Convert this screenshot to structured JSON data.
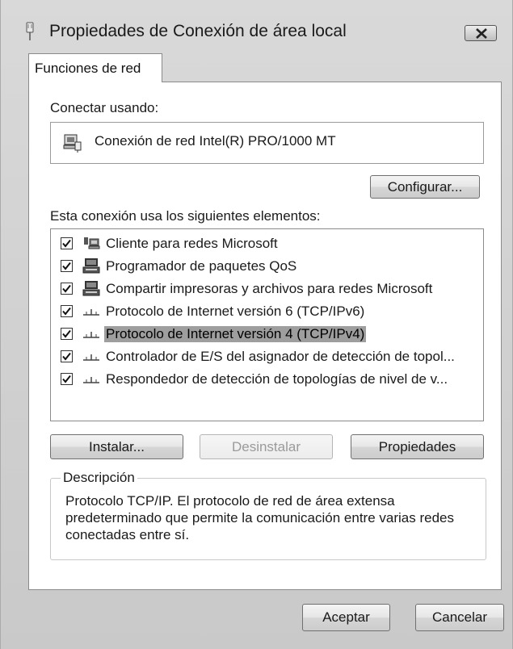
{
  "window": {
    "title": "Propiedades de Conexión de área local"
  },
  "tabs": [
    {
      "label": "Funciones de red"
    }
  ],
  "connect": {
    "label": "Conectar usando:",
    "adapter": "Conexión de red Intel(R) PRO/1000 MT",
    "configure_button": "Configurar..."
  },
  "items_label": "Esta conexión usa los siguientes elementos:",
  "items": [
    {
      "label": "Cliente para redes Microsoft",
      "checked": true,
      "icon": "network-client-icon"
    },
    {
      "label": "Programador de paquetes QoS",
      "checked": true,
      "icon": "service-icon"
    },
    {
      "label": "Compartir impresoras y archivos para redes Microsoft",
      "checked": true,
      "icon": "service-icon"
    },
    {
      "label": "Protocolo de Internet versión 6 (TCP/IPv6)",
      "checked": true,
      "icon": "protocol-icon"
    },
    {
      "label": "Protocolo de Internet versión 4 (TCP/IPv4)",
      "checked": true,
      "icon": "protocol-icon",
      "selected": true
    },
    {
      "label": "Controlador de E/S del asignador de detección de topol...",
      "checked": true,
      "icon": "protocol-icon"
    },
    {
      "label": "Respondedor de detección de topologías de nivel de v...",
      "checked": true,
      "icon": "protocol-icon"
    }
  ],
  "buttons": {
    "install": "Instalar...",
    "uninstall": "Desinstalar",
    "properties": "Propiedades",
    "accept": "Aceptar",
    "cancel": "Cancelar"
  },
  "description": {
    "title": "Descripción",
    "text": "Protocolo TCP/IP. El protocolo de red de área extensa predeterminado que permite la comunicación entre varias redes conectadas entre sí."
  },
  "colors": {
    "selection": "#9e9e9e",
    "window_bg": "#cfcfcf"
  }
}
